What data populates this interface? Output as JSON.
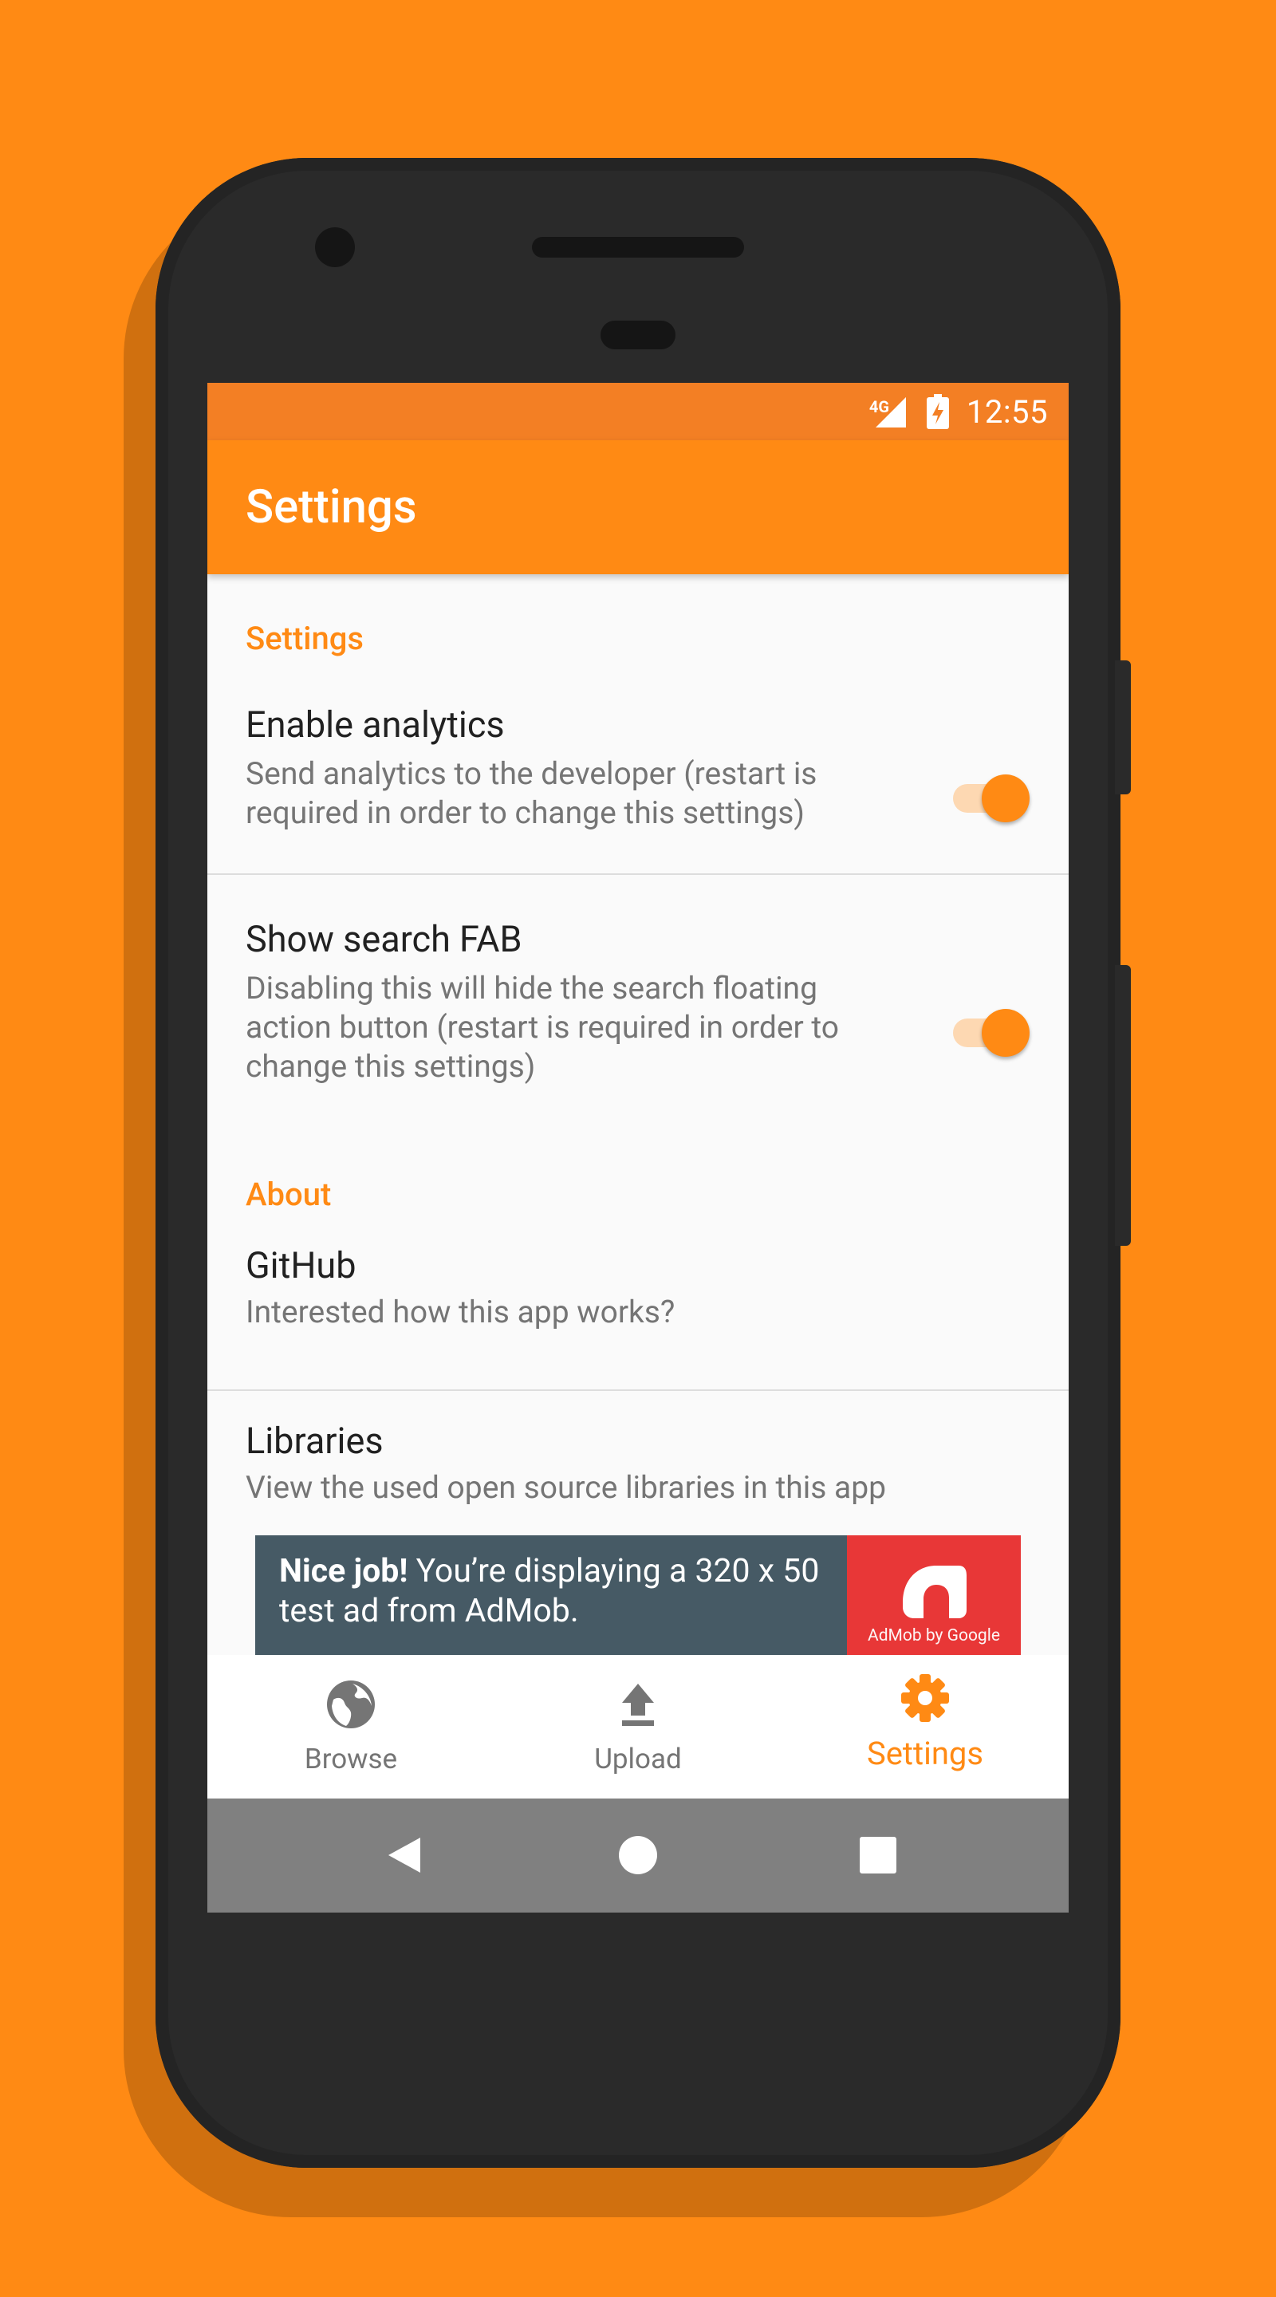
{
  "status_bar": {
    "network": "4G",
    "time": "12:55"
  },
  "app_bar": {
    "title": "Settings"
  },
  "sections": {
    "settings": {
      "header": "Settings",
      "analytics": {
        "title": "Enable analytics",
        "summary": "Send analytics to the developer (restart is required in order to change this settings)",
        "enabled": true
      },
      "search_fab": {
        "title": "Show search FAB",
        "summary": "Disabling this will hide the search floating action button (restart is required in order to change this settings)",
        "enabled": true
      }
    },
    "about": {
      "header": "About",
      "github": {
        "title": "GitHub",
        "summary": "Interested how this app works?"
      },
      "libraries": {
        "title": "Libraries",
        "summary": "View the used open source libraries in this app"
      }
    }
  },
  "ad": {
    "bold": "Nice job!",
    "text": " You’re displaying a 320 x 50 test ad from AdMob.",
    "brand": "AdMob by Google"
  },
  "bottom_nav": {
    "items": [
      {
        "label": "Browse",
        "icon": "globe-icon",
        "active": false
      },
      {
        "label": "Upload",
        "icon": "upload-icon",
        "active": false
      },
      {
        "label": "Settings",
        "icon": "gear-icon",
        "active": true
      }
    ]
  },
  "colors": {
    "accent": "#FF8A14",
    "status_bar": "#F37F24",
    "ad_background": "#465A65",
    "ad_logo_background": "#E83737"
  }
}
